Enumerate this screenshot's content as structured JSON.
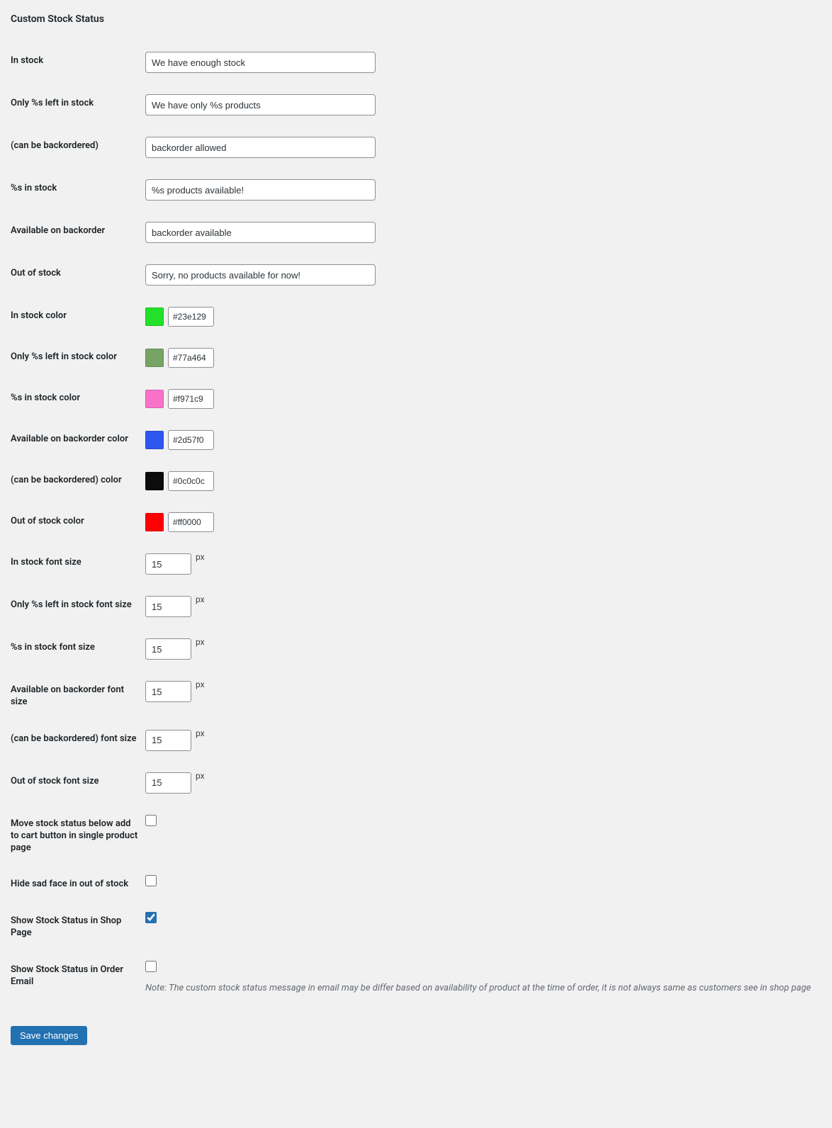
{
  "title": "Custom Stock Status",
  "text_fields": [
    {
      "label": "In stock",
      "value": "We have enough stock"
    },
    {
      "label": "Only %s left in stock",
      "value": "We have only %s products"
    },
    {
      "label": "(can be backordered)",
      "value": "backorder allowed"
    },
    {
      "label": "%s in stock",
      "value": "%s products available!"
    },
    {
      "label": "Available on backorder",
      "value": "backorder available"
    },
    {
      "label": "Out of stock",
      "value": "Sorry, no products available for now!"
    }
  ],
  "color_fields": [
    {
      "label": "In stock color",
      "value": "#23e129"
    },
    {
      "label": "Only %s left in stock color",
      "value": "#77a464"
    },
    {
      "label": "%s in stock color",
      "value": "#f971c9"
    },
    {
      "label": "Available on backorder color",
      "value": "#2d57f0"
    },
    {
      "label": "(can be backordered) color",
      "value": "#0c0c0c"
    },
    {
      "label": "Out of stock color",
      "value": "#ff0000"
    }
  ],
  "size_fields": [
    {
      "label": "In stock font size",
      "value": "15",
      "unit": "px"
    },
    {
      "label": "Only %s left in stock font size",
      "value": "15",
      "unit": "px"
    },
    {
      "label": "%s in stock font size",
      "value": "15",
      "unit": "px"
    },
    {
      "label": "Available on backorder font size",
      "value": "15",
      "unit": "px"
    },
    {
      "label": "(can be backordered) font size",
      "value": "15",
      "unit": "px"
    },
    {
      "label": "Out of stock font size",
      "value": "15",
      "unit": "px"
    }
  ],
  "checkbox_fields": [
    {
      "label": "Move stock status below add to cart button in single product page",
      "checked": false,
      "note": ""
    },
    {
      "label": "Hide sad face in out of stock",
      "checked": false,
      "note": ""
    },
    {
      "label": "Show Stock Status in Shop Page",
      "checked": true,
      "note": ""
    },
    {
      "label": "Show Stock Status in Order Email",
      "checked": false,
      "note": "Note: The custom stock status message in email may be differ based on availability of product at the time of order, it is not always same as customers see in shop page"
    }
  ],
  "submit_label": "Save changes"
}
